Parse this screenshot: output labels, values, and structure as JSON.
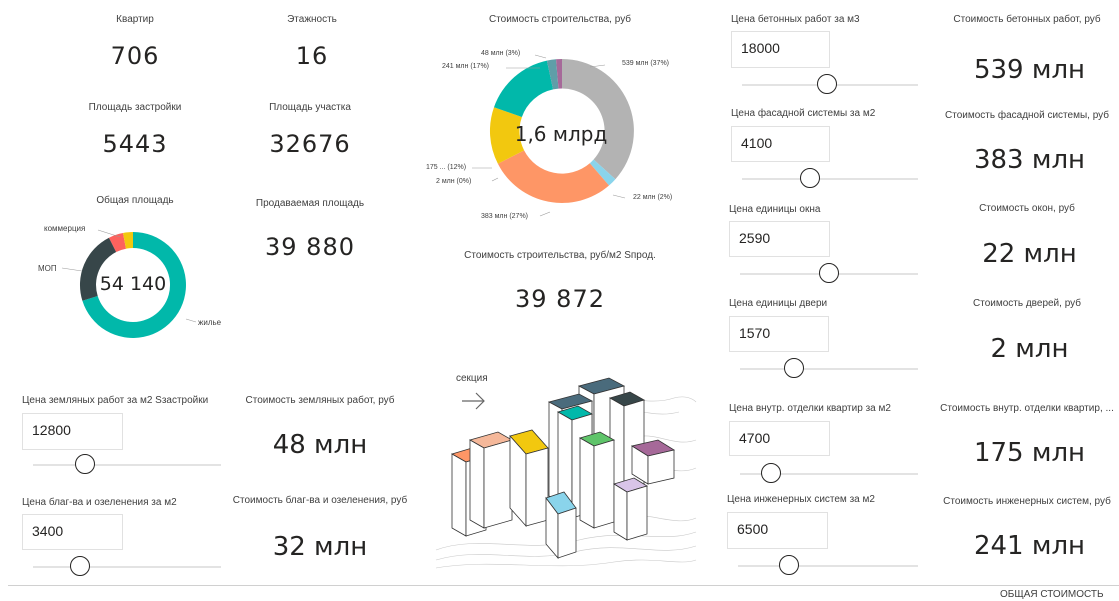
{
  "kpis": {
    "apartments": {
      "label": "Квартир",
      "value": "706"
    },
    "floors": {
      "label": "Этажность",
      "value": "16"
    },
    "build_area": {
      "label": "Площадь застройки",
      "value": "5443"
    },
    "site_area": {
      "label": "Площадь участка",
      "value": "32676"
    },
    "sellable_area": {
      "label": "Продаваемая площадь",
      "value": "39 880"
    },
    "cost_per_m2": {
      "label": "Стоимость строительства, руб/м2 Sпрод.",
      "value": "39 872"
    }
  },
  "total_area_chart": {
    "title": "Общая площадь",
    "center": "54 140",
    "labels": {
      "commerce": "коммерция",
      "mop": "МОП",
      "living": "жилье"
    }
  },
  "cost_chart": {
    "title": "Стоимость строительства, руб",
    "center": "1,6 млрд",
    "labels": {
      "concrete": "539 млн (37%)",
      "doors": "22 млн (2%)",
      "facade": "383 млн (27%)",
      "windows": "2 млн (0%)",
      "interior": "175 ... (12%)",
      "engineering": "241 млн (17%)",
      "earthworks": "48 млн (3%)"
    }
  },
  "left_inputs": {
    "earthworks": {
      "label": "Цена земляных работ за м2 Sзастройки",
      "value": "12800",
      "result_label": "Стоимость земляных работ, руб",
      "result": "48 млн"
    },
    "landscaping": {
      "label": "Цена благ-ва и озеленения за м2",
      "value": "3400",
      "result_label": "Стоимость благ-ва и озеленения, руб",
      "result": "32 млн"
    }
  },
  "image": {
    "caption": "секция"
  },
  "right_inputs": [
    {
      "label": "Цена бетонных работ за м3",
      "value": "18000",
      "result_label": "Стоимость бетонных работ, руб",
      "result": "539 млн"
    },
    {
      "label": "Цена фасадной системы за м2",
      "value": "4100",
      "result_label": "Стоимость фасадной системы, руб",
      "result": "383 млн"
    },
    {
      "label": "Цена единицы окна",
      "value": "2590",
      "result_label": "Стоимость окон, руб",
      "result": "22 млн"
    },
    {
      "label": "Цена единицы двери",
      "value": "1570",
      "result_label": "Стоимость дверей, руб",
      "result": "2 млн"
    },
    {
      "label": "Цена внутр. отделки квартир за м2",
      "value": "4700",
      "result_label": "Стоимость внутр. отделки квартир, ...",
      "result": "175 млн"
    },
    {
      "label": "Цена инженерных систем за м2",
      "value": "6500",
      "result_label": "Стоимость инженерных систем, руб",
      "result": "241 млн"
    }
  ],
  "footer": {
    "label": "ОБЩАЯ СТОИМОСТЬ"
  },
  "colors": {
    "teal": "#01b8aa",
    "dark": "#374649",
    "red": "#fd625e",
    "yellow": "#f2c80f",
    "gray": "#b3b3b3",
    "lightblue": "#8ad4eb",
    "orange": "#fe9666",
    "purple": "#a66999"
  }
}
